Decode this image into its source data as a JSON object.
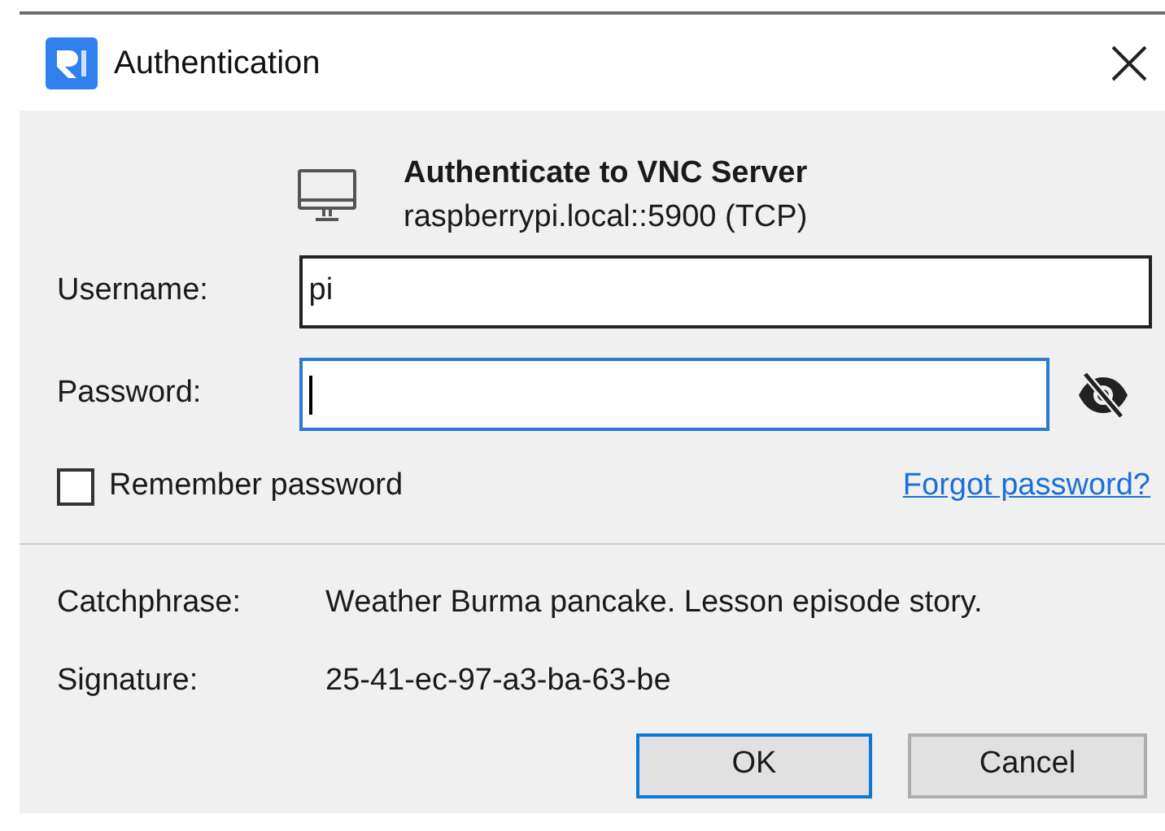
{
  "window": {
    "title": "Authentication"
  },
  "header": {
    "title": "Authenticate to VNC Server",
    "server": "raspberrypi.local::5900 (TCP)"
  },
  "fields": [
    {
      "label": "Username:",
      "value": "pi",
      "focused": false,
      "kind": "text"
    },
    {
      "label": "Password:",
      "focused": true,
      "kind": "password"
    }
  ],
  "remember_password": {
    "label": "Remember password",
    "checked": false
  },
  "forgot_link": "Forgot password?",
  "info": [
    {
      "label": "Catchphrase:",
      "value": "Weather Burma pancake. Lesson episode story."
    },
    {
      "label": "Signature:",
      "value": "25-41-ec-97-a3-ba-63-be"
    }
  ],
  "buttons": [
    {
      "label": "OK",
      "default": true
    },
    {
      "label": "Cancel",
      "default": false
    }
  ]
}
